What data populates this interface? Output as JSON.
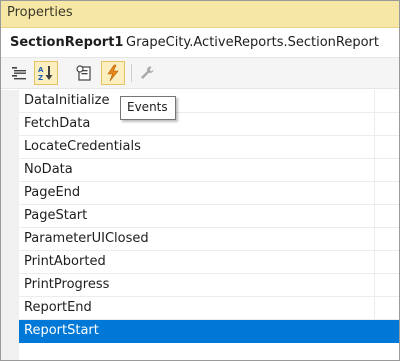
{
  "window": {
    "title": "Properties"
  },
  "object": {
    "name": "SectionReport1",
    "type": "GrapeCity.ActiveReports.SectionReport"
  },
  "toolbar": {
    "buttons": [
      {
        "name": "categorized",
        "icon": "categorized-icon",
        "checked": false
      },
      {
        "name": "alphabetical",
        "icon": "alphabetical-sort-icon",
        "checked": true
      },
      {
        "name": "properties",
        "icon": "properties-page-icon",
        "checked": false
      },
      {
        "name": "events",
        "icon": "lightning-bolt-icon",
        "checked": true
      },
      {
        "name": "property-pages",
        "icon": "wrench-icon",
        "checked": false,
        "disabled": true
      }
    ],
    "tooltip": "Events"
  },
  "events": {
    "items": [
      {
        "label": "DataInitialize"
      },
      {
        "label": "FetchData"
      },
      {
        "label": "LocateCredentials"
      },
      {
        "label": "NoData"
      },
      {
        "label": "PageEnd"
      },
      {
        "label": "PageStart"
      },
      {
        "label": "ParameterUIClosed"
      },
      {
        "label": "PrintAborted"
      },
      {
        "label": "PrintProgress"
      },
      {
        "label": "ReportEnd"
      },
      {
        "label": "ReportStart"
      }
    ],
    "selected": "ReportStart"
  },
  "colors": {
    "title_bar": "#f6e7a6",
    "selection": "#0078d7",
    "checked_button": "#fcefbf"
  }
}
